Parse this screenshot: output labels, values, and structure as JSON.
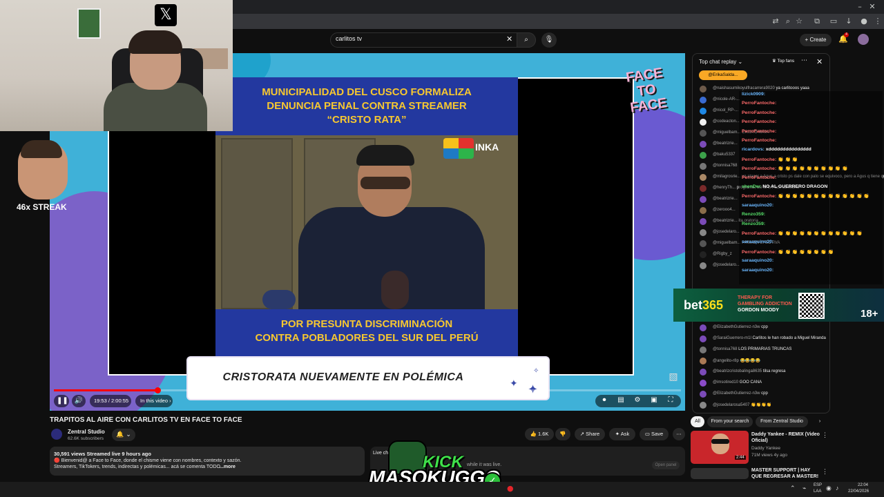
{
  "youtube": {
    "search_query": "carlitos tv",
    "create_label": "Create",
    "notification_count": "4"
  },
  "overlay": {
    "x_logo": "𝕏",
    "streak": "46x STREAK"
  },
  "video": {
    "news_headline": [
      "MUNICIPALIDAD DEL CUSCO FORMALIZA",
      "DENUNCIA PENAL CONTRA STREAMER",
      "“CRISTO RATA”"
    ],
    "news_footer": [
      "POR PRESUNTA DISCRIMINACIÓN",
      "CONTRA POBLADORES DEL SUR DEL PERÚ"
    ],
    "inka_logo_text": "INKA",
    "lower_third": "CRISTORATA NUEVAMENTE EN POLÉMICA",
    "show_logo": "FACE TO FACE",
    "time_label": "19:53 / 2:00:55",
    "chapter_label": "In this video",
    "progress_fraction": 0.165
  },
  "below_video": {
    "title": "TRAPITOS AL AIRE CON CARLITOS TV EN FACE TO FACE",
    "channel": "Zentral Studio",
    "subscribers": "62.6K subscribers",
    "likes": "1.6K",
    "share": "Share",
    "ask": "Ask",
    "save": "Save",
    "desc_meta": "30,591 views  Streamed live 9 hours ago",
    "desc_line1": "🔴 Bienvenid@ a Face to Face, donde el chisme viene con nombres, contexto y sazón.",
    "desc_line2": "Streamers, TikTokers, trends, indirectas y polémicas... acá se comenta TODO",
    "desc_more": "...more",
    "live_chat_title": "Live chat",
    "live_chat_note": "while it was live.",
    "open_panel": "Open panel"
  },
  "kick_logo": {
    "top": "KICK",
    "bottom": "MASOKUGGO"
  },
  "chat": {
    "title": "Top chat replay",
    "top_fans": "Top fans",
    "pinned_user": "@ErikaSalda...",
    "messages": [
      {
        "user": "@naishasumikoyulfracarrera9020",
        "text": "ya carlitooos yaaa",
        "color": "#6d5a4a"
      },
      {
        "user": "@nicole-AR-...",
        "text": "",
        "color": "#3a6bd1"
      },
      {
        "user": "@nicol_RP-...",
        "text": "",
        "color": "#1e88e5"
      },
      {
        "user": "@codeacton...",
        "text": "",
        "color": "#eeeeee"
      },
      {
        "user": "@miguelbam...",
        "text": "CRISTO RATA",
        "color": "#555555"
      },
      {
        "user": "@beatrizrie...",
        "text": "",
        "color": "#7b4bb8"
      },
      {
        "user": "@baku5337",
        "text": "",
        "color": "#3ca14a"
      },
      {
        "user": "@tonnisa768",
        "text": "",
        "color": "#777777"
      },
      {
        "user": "@milagrosrie...",
        "text": "xq atacar a Agus a cristo ps dale con palo se equivoco, pero a Agus q tiene que ver",
        "color": "#aa8866"
      },
      {
        "user": "@henryTh...",
        "text": "programa, we la lo Face convierte",
        "color": "#7a2a2a"
      },
      {
        "user": "@beatrizrie...",
        "text": "",
        "color": "#7b4bb8"
      },
      {
        "user": "@zerooo4...",
        "text": "",
        "color": "#8a6d4a"
      },
      {
        "user": "@beatrizrie...",
        "text": "ita oratoria",
        "color": "#7b4bb8"
      },
      {
        "user": "@josedelaro...",
        "text": "",
        "color": "#888888"
      },
      {
        "user": "@miguelbam...",
        "text": "PRISION EFECTIVA",
        "color": "#555555"
      },
      {
        "user": "@Rigby_z",
        "text": "",
        "color": "#222222"
      },
      {
        "user": "@josedelaro...",
        "text": "",
        "color": "#888888"
      },
      {
        "user": "@ElizabethGutierrez-n3w",
        "text": "cpp",
        "color": "#7b4bb8"
      },
      {
        "user": "@SaraiGuerrero-m1l",
        "text": "Carlitos le han robado a Miguel Miranda",
        "color": "#7b4bb8"
      },
      {
        "user": "@tonnisa768",
        "text": "LOS PRIMARIAS TRUNCAS",
        "color": "#777777"
      },
      {
        "user": "@angelito-r8p",
        "text": "😂😂😂😂",
        "color": "#aa7a55"
      },
      {
        "user": "@beatrizcristobalinga8635",
        "text": "tilsa regresa",
        "color": "#7b4bb8"
      },
      {
        "user": "@imsotired10",
        "text": "GOO CANA",
        "color": "#8a4bc8"
      },
      {
        "user": "@ElizabethGutierrez-n3w",
        "text": "cpp",
        "color": "#7b4bb8"
      },
      {
        "user": "@josedelarosa5407",
        "text": "👏👏👏👏",
        "color": "#888888"
      }
    ]
  },
  "kick_chat": [
    {
      "user": "lizick0909:",
      "text": "",
      "style": "kuser2"
    },
    {
      "user": "PerroFantoche:",
      "text": "",
      "style": "kuser"
    },
    {
      "user": "PerroFantoche:",
      "text": "",
      "style": "kuser"
    },
    {
      "user": "PerroFantoche:",
      "text": "",
      "style": "kuser"
    },
    {
      "user": "PerroFantoche:",
      "text": "",
      "style": "kuser"
    },
    {
      "user": "PerroFantoche:",
      "text": "",
      "style": "kuser"
    },
    {
      "user": "ricardovs:",
      "text": "xddddddddddddddd",
      "style": "kuser2"
    },
    {
      "user": "PerroFantoche:",
      "text": "👏 👏 👏",
      "style": "kuser"
    },
    {
      "user": "PerroFantoche:",
      "text": "👏 👏 👏 👏 👏 👏 👏 👏 👏 👏",
      "style": "kuser"
    },
    {
      "user": "PerroFantoche:",
      "text": "",
      "style": "kuser"
    },
    {
      "user": "shenDw:",
      "text": "NO AL GUERRERO DRAGON",
      "style": "kuser3"
    },
    {
      "user": "PerroFantoche:",
      "text": "👏 👏 👏 👏 👏 👏 👏 👏 👏 👏 👏 👏 👏",
      "style": "kuser"
    },
    {
      "user": "saraaquino20:",
      "text": "",
      "style": "kuser2"
    },
    {
      "user": "Renzo359:",
      "text": "",
      "style": "kuser3"
    },
    {
      "user": "Renzo359:",
      "text": "",
      "style": "kuser3"
    },
    {
      "user": "PerroFantoche:",
      "text": "👏 👏 👏 👏 👏 👏 👏 👏 👏 👏 👏 👏",
      "style": "kuser"
    },
    {
      "user": "saraaquino20:",
      "text": "",
      "style": "kuser2"
    },
    {
      "user": "PerroFantoche:",
      "text": "👏 👏 👏 👏 👏 👏 👏 👏",
      "style": "kuser"
    },
    {
      "user": "saraaquino20:",
      "text": "",
      "style": "kuser2"
    },
    {
      "user": "saraaquino20:",
      "text": "",
      "style": "kuser2"
    }
  ],
  "bet_banner": {
    "logo_a": "bet",
    "logo_b": "365",
    "line1": "THERAPY FOR",
    "line2": "GAMBLING ADDICTION",
    "line3": "GORDON MOODY",
    "age": "18+"
  },
  "recs": {
    "chips": [
      "All",
      "From your search",
      "From Zentral Studio"
    ],
    "r1_title": "Daddy Yankee - REMIX (Video Oficial)",
    "r1_channel": "Daddy Yankee",
    "r1_meta": "71M views  4y ago",
    "r1_duration": "2:44",
    "r2_title": "MASTER SUPPORT | HAY QUE REGRESAR A MASTER! ..."
  },
  "taskbar": {
    "lang1": "ESP",
    "lang2": "LAA",
    "time": "22:04",
    "date": "22/04/2026"
  },
  "colors": {
    "accent": "#ff0000",
    "player_bg": "#3fb1d8",
    "news_yellow": "#f7c830",
    "news_blue": "#23389f"
  }
}
